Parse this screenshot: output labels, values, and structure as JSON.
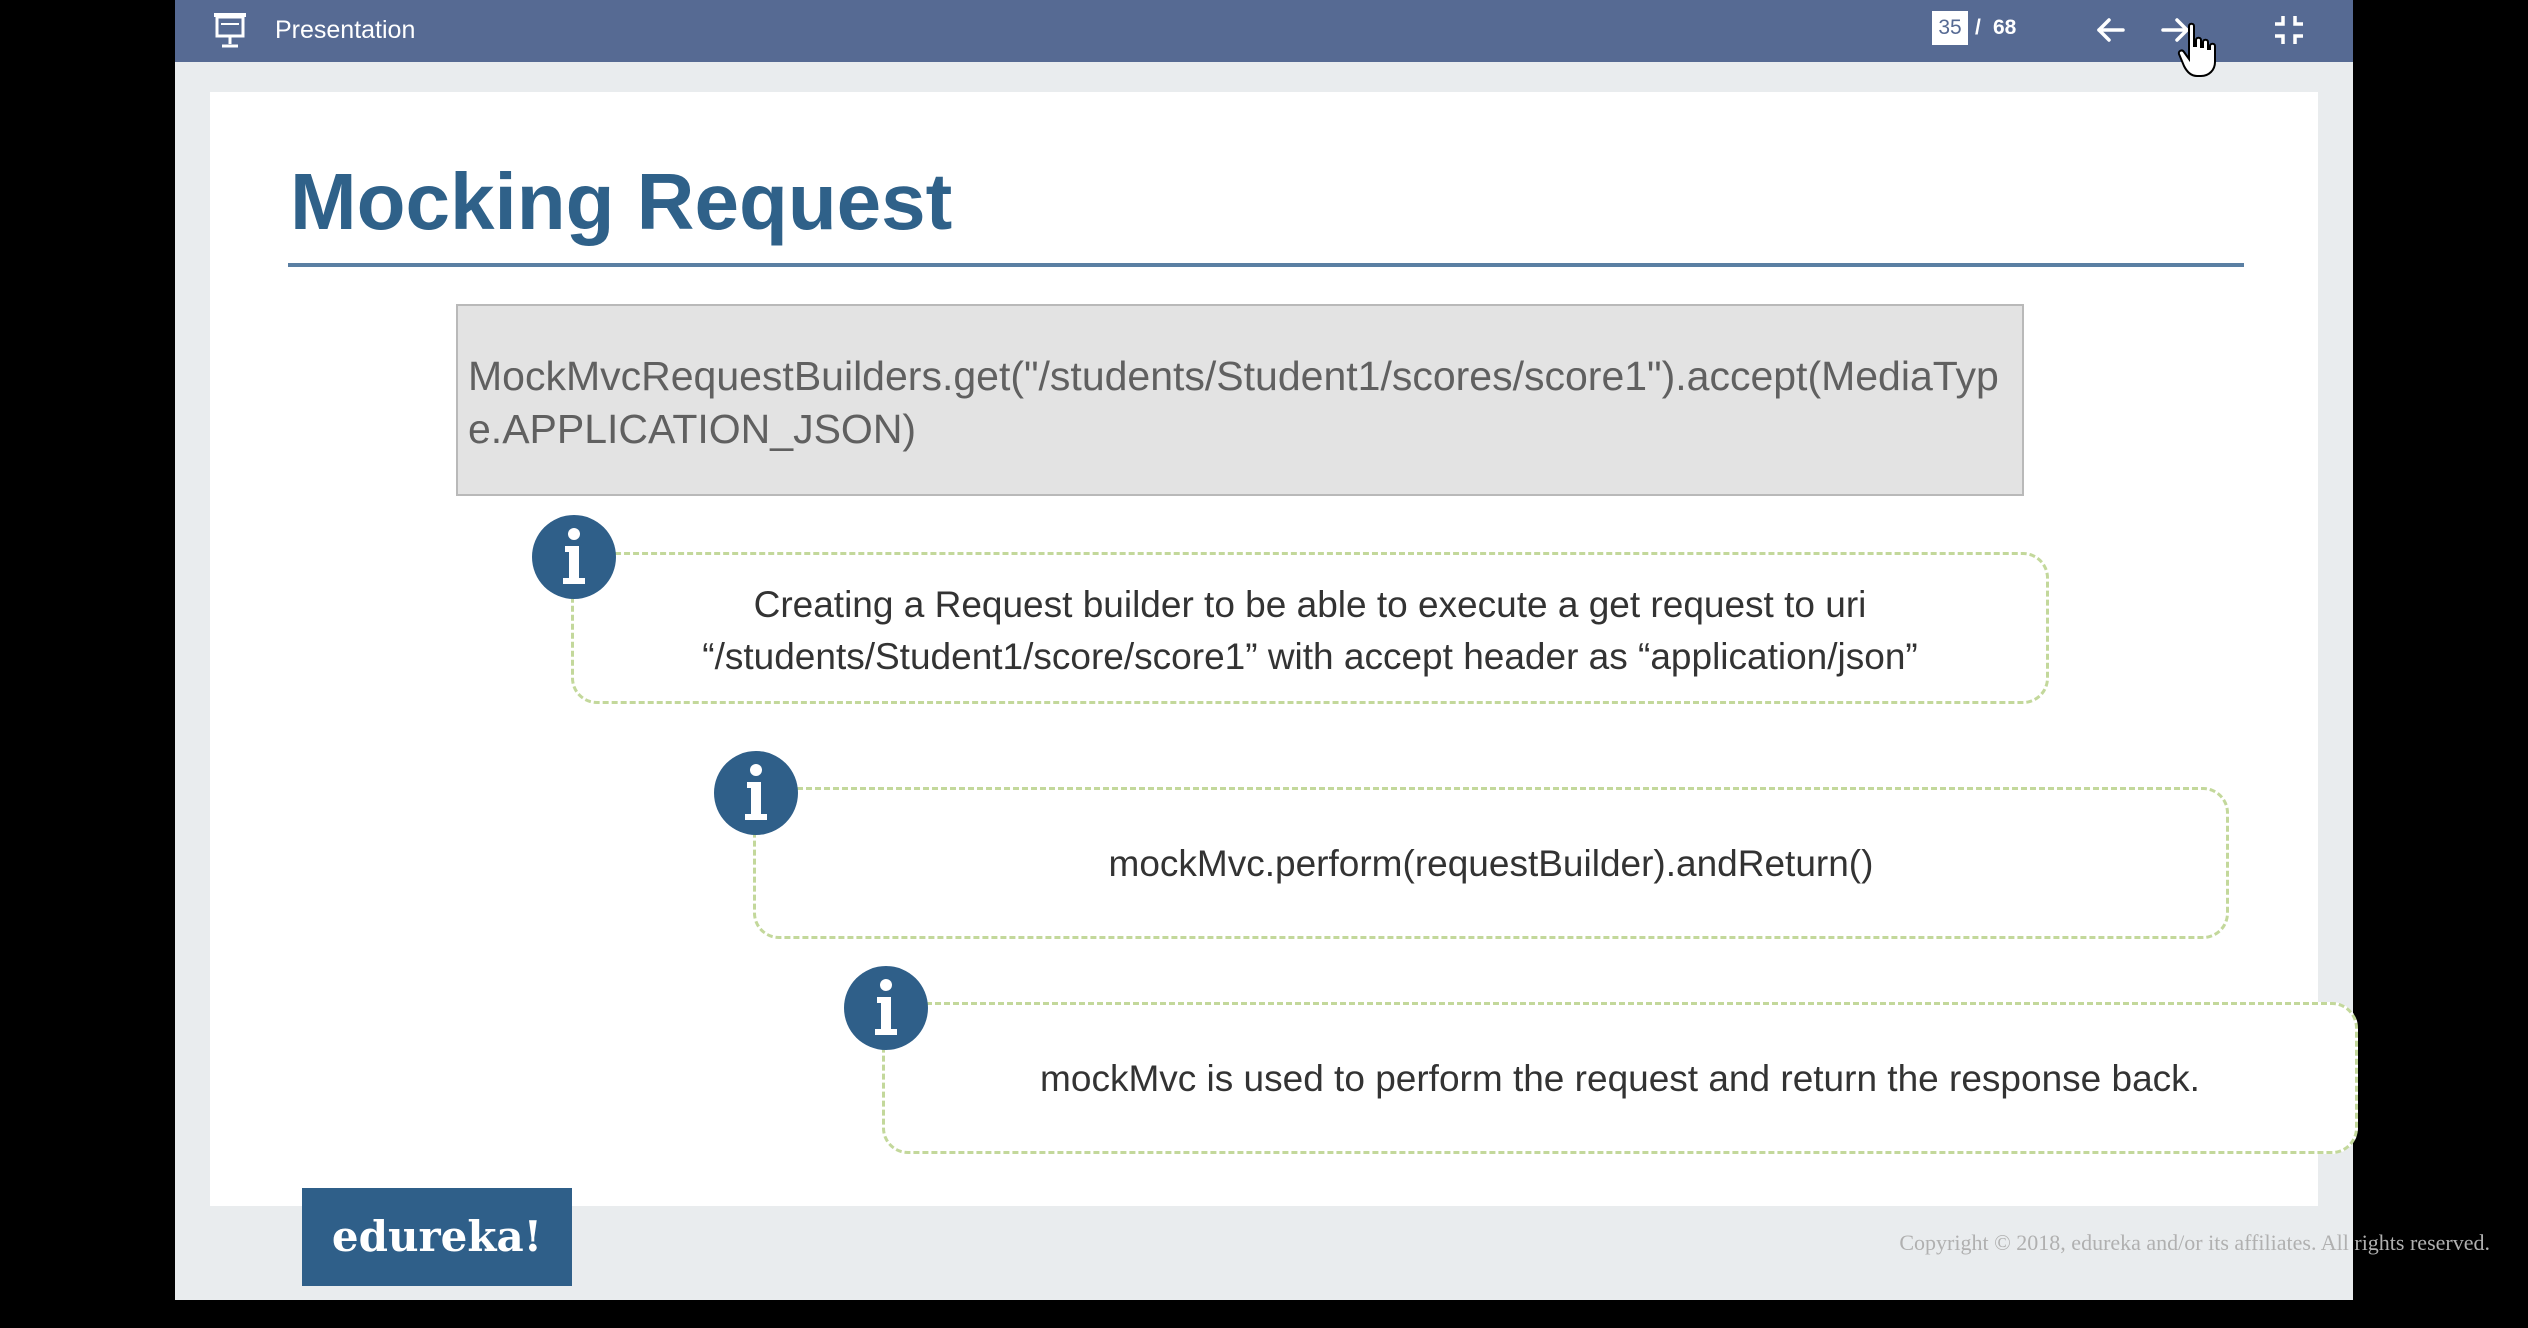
{
  "toolbar": {
    "title": "Presentation",
    "current_page": "35",
    "page_separator": "/",
    "total_pages": "68",
    "icons": {
      "presentation": "presentation-icon",
      "prev": "arrow-left-icon",
      "next": "arrow-right-icon",
      "exit_fullscreen": "exit-fullscreen-icon",
      "cursor": "hand-pointer-icon"
    }
  },
  "slide": {
    "title": "Mocking Request",
    "code": "MockMvcRequestBuilders.get(\"/students/Student1/scores/score1\").accept(MediaType.APPLICATION_JSON)",
    "notes": [
      {
        "line1": "Creating a Request builder to be able to execute a get request to uri",
        "line2": "“/students/Student1/score/score1” with accept header as “application/json”"
      },
      {
        "line1": "mockMvc.perform(requestBuilder).andReturn()"
      },
      {
        "line1": "mockMvc is used to perform the request and return the response back."
      }
    ],
    "logo": "edureka!",
    "copyright": "Copyright © 2018, edureka and/or its affiliates. All rights reserved."
  },
  "colors": {
    "toolbar": "#566a93",
    "title": "#2f6189",
    "info_icon": "#2f5f89",
    "note_border": "#c3d89b",
    "code_bg": "#e3e3e3"
  }
}
